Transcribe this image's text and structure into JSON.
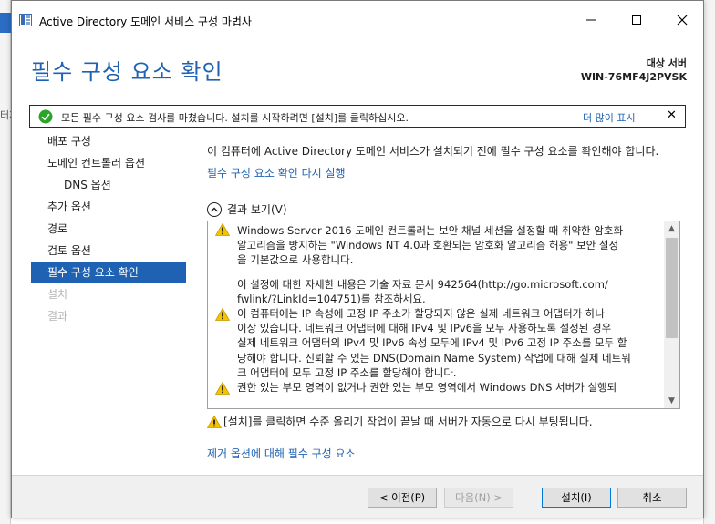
{
  "window": {
    "title": "Active Directory 도메인 서비스 구성 마법사",
    "minimize": "—",
    "maximize": "☐",
    "close": "✕"
  },
  "header": {
    "page_title": "필수 구성 요소 확인",
    "target_label": "대상 서버",
    "target_name": "WIN-76MF4J2PVSK"
  },
  "notice": {
    "text": "모든 필수 구성 요소 검사를 마쳤습니다. 설치를 시작하려면 [설치]를 클릭하십시오.",
    "more": "더 많이 표시",
    "close": "✕"
  },
  "nav": {
    "items": [
      {
        "label": "배포 구성",
        "state": "normal"
      },
      {
        "label": "도메인 컨트롤러 옵션",
        "state": "normal"
      },
      {
        "label": "DNS 옵션",
        "state": "sub"
      },
      {
        "label": "추가 옵션",
        "state": "normal"
      },
      {
        "label": "경로",
        "state": "normal"
      },
      {
        "label": "검토 옵션",
        "state": "normal"
      },
      {
        "label": "필수 구성 요소 확인",
        "state": "active"
      },
      {
        "label": "설치",
        "state": "disabled"
      },
      {
        "label": "결과",
        "state": "disabled"
      }
    ]
  },
  "content": {
    "intro": "이 컴퓨터에 Active Directory 도메인 서비스가 설치되기 전에 필수 구성 요소를 확인해야 합니다.",
    "rerun": "필수 구성 요소 확인 다시 실행",
    "results_toggle": "결과 보기(V)",
    "results": [
      {
        "lines": [
          "Windows Server 2016 도메인 컨트롤러는 보안 채널 세션을 설정할 때 취약한 암호화",
          "알고리즘을 방지하는 \"Windows NT 4.0과 호환되는 암호화 알고리즘 허용\" 보안 설정",
          "을 기본값으로 사용합니다."
        ],
        "extra": [
          "이 설정에 대한 자세한 내용은 기술 자료 문서 942564(http://go.microsoft.com/",
          "fwlink/?LinkId=104751)를 참조하세요."
        ]
      },
      {
        "lines": [
          "이 컴퓨터에는 IP 속성에 고정 IP 주소가 할당되지 않은 실제 네트워크 어댑터가 하나",
          "이상 있습니다. 네트워크 어댑터에 대해 IPv4 및 IPv6을 모두 사용하도록 설정된 경우",
          "실제 네트워크 어댑터의 IPv4 및 IPv6 속성 모두에 IPv4 및 IPv6 고정 IP 주소를 모두 할",
          "당해야 합니다. 신뢰할 수 있는 DNS(Domain Name System) 작업에 대해 실제 네트워",
          "크 어댑터에 모두 고정 IP 주소를 할당해야 합니다."
        ],
        "extra": []
      },
      {
        "lines": [
          "권한 있는 부모 영역이 없거나 권한 있는 부모 영역에서 Windows DNS 서버가 실행되"
        ],
        "extra": []
      }
    ],
    "reboot_note": "[설치]를 클릭하면 수준 올리기 작업이 끝날 때 서버가 자동으로 다시 부팅됩니다.",
    "more_link": "제거 옵션에 대해 필수 구성 요소"
  },
  "footer": {
    "prev": "< 이전(P)",
    "next": "다음(N) >",
    "install": "설치(I)",
    "cancel": "취소"
  },
  "colors": {
    "accent": "#1f62b3",
    "success": "#2aa52a",
    "warning": "#f5c400"
  },
  "background": {
    "edge_text": "터져"
  }
}
